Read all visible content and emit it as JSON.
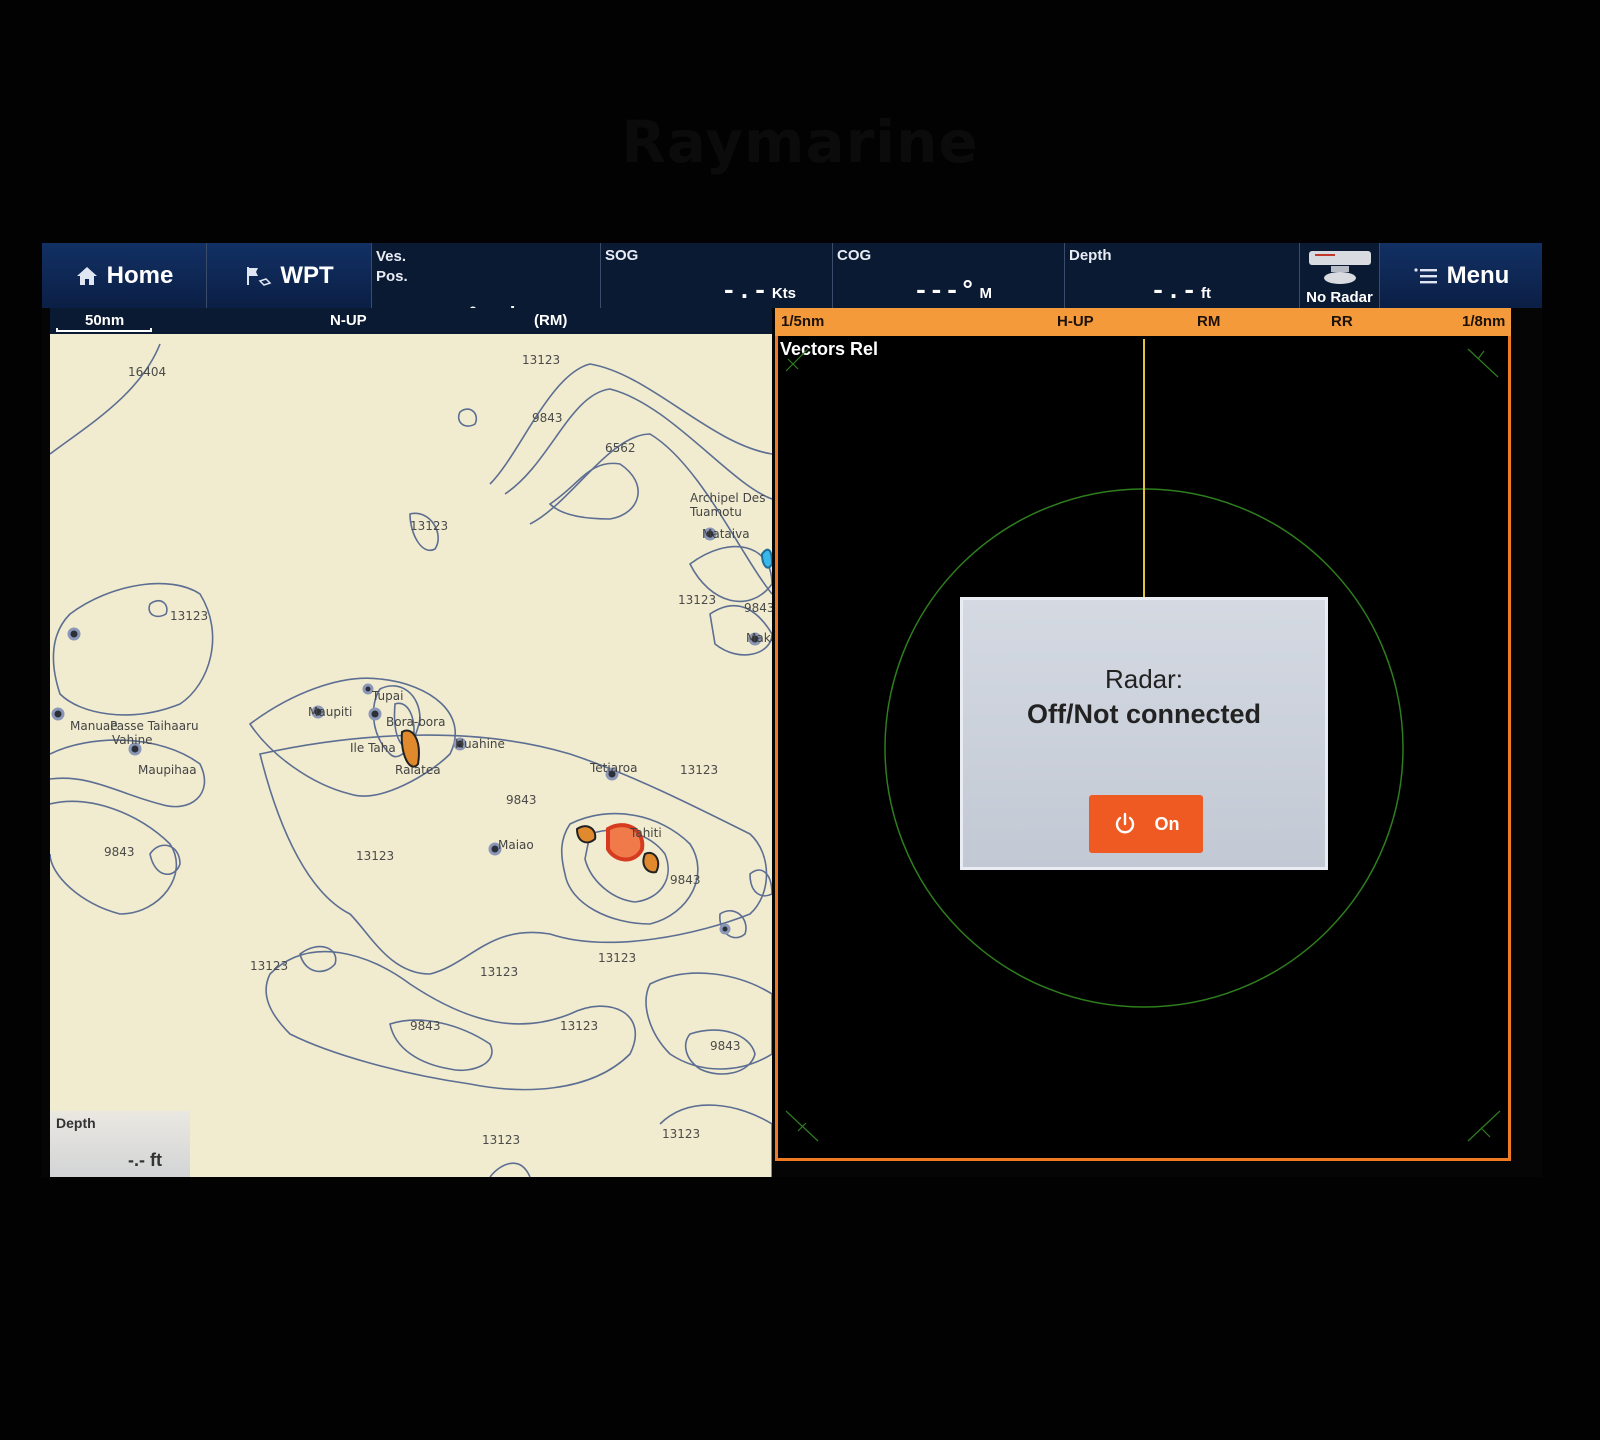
{
  "bezel": {
    "brand": "Raymarine"
  },
  "topbar": {
    "home_label": "Home",
    "wpt_label": "WPT",
    "vessel_pos": {
      "label_line1": "Ves.",
      "label_line2": "Pos.",
      "line1": "--°--'.---",
      "line2": "---°--'.---"
    },
    "sog": {
      "label": "SOG",
      "value": "-.-",
      "unit": "Kts"
    },
    "cog": {
      "label": "COG",
      "value": "---°",
      "unit": "M"
    },
    "depth": {
      "label": "Depth",
      "value": "-.-",
      "unit": "ft"
    },
    "radar_status": {
      "label": "No Radar",
      "icon": "radar-scanner-icon"
    },
    "menu_label": "Menu"
  },
  "chart": {
    "scale": "50nm",
    "orientation": "N-UP",
    "motion": "(RM)",
    "depth_labels": [
      "16404",
      "13123",
      "9843",
      "6562",
      "13123",
      "13123",
      "13123",
      "9843",
      "13123",
      "9843",
      "13123",
      "9843",
      "13123",
      "13123",
      "13123",
      "9843",
      "13123",
      "9843",
      "13123",
      "13123",
      "9843"
    ],
    "place_names": [
      "Archipel Des",
      "Tuamotu",
      "Mataiva",
      "Maka",
      "Tupai",
      "Maupiti",
      "Bora-bora",
      "Ile Taha",
      "Huahine",
      "Raiatea",
      "Manuae",
      "Passe Taihaaru",
      "Vahine",
      "Maupihaa",
      "Tetiaroa",
      "Tahiti",
      "Maiao"
    ],
    "depth_box": {
      "label": "Depth",
      "value": "-.- ft"
    }
  },
  "radar": {
    "range_left": "1/5nm",
    "orientation": "H-UP",
    "motion": "RM",
    "vector_mode": "RR",
    "range_right": "1/8nm",
    "vectors_label": "Vectors Rel",
    "dialog": {
      "title": "Radar:",
      "status": "Off/Not connected",
      "button_label": "On"
    }
  },
  "colors": {
    "orange": "#f07a22",
    "navy": "#0a1a33",
    "chart_bg": "#f1eccf",
    "contour": "#5d6e93"
  }
}
